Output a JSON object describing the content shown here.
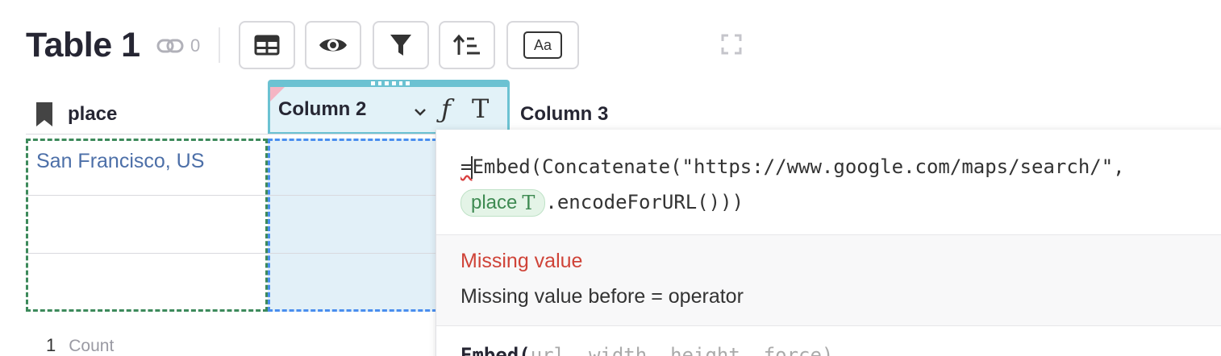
{
  "header": {
    "title": "Table 1",
    "link_count": "0"
  },
  "toolbar": {
    "buttons": [
      {
        "name": "table-widget-icon"
      },
      {
        "name": "eye-icon"
      },
      {
        "name": "filter-icon"
      },
      {
        "name": "sort-icon"
      },
      {
        "name": "text-style-icon",
        "label": "Aa"
      }
    ]
  },
  "columns": [
    {
      "label": "place",
      "icon": "bookmark-icon"
    },
    {
      "label": "Column 2"
    },
    {
      "label": "Column 3"
    }
  ],
  "rows": [
    {
      "place": "San Francisco, US"
    },
    {
      "place": ""
    },
    {
      "place": ""
    }
  ],
  "footer": {
    "count_value": "1",
    "count_label": "Count"
  },
  "formula_editor": {
    "prefix": "=",
    "line1": "Embed(Concatenate(\"https://www.google.com/maps/search/\",",
    "token_label": "place",
    "line2_rest": ".encodeForURL()))",
    "error_title": "Missing value",
    "error_message": "Missing value before = operator",
    "function_name": "Embed(",
    "function_params": "url, width, height, force)"
  },
  "colors": {
    "accent_teal": "#6cc2d2",
    "error_red": "#cf4338",
    "token_green": "#3e8a52",
    "link_blue": "#4c6fa8"
  }
}
